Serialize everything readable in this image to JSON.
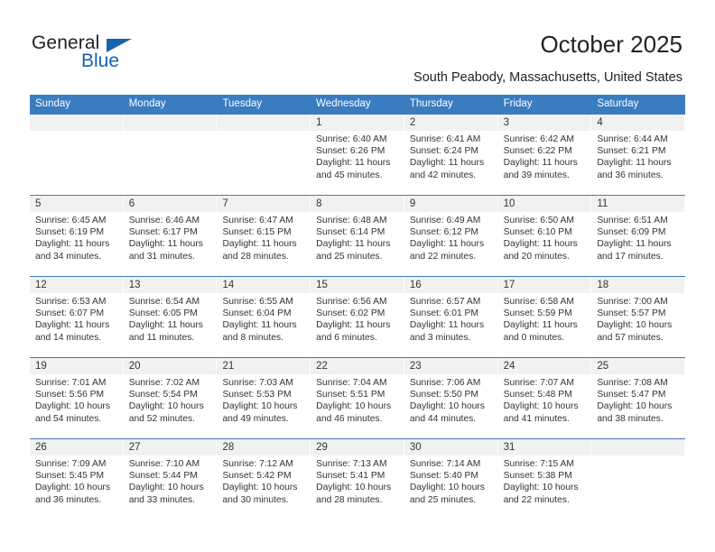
{
  "brand": {
    "name_part1": "General",
    "name_part2": "Blue",
    "accent_color": "#1565ae"
  },
  "header": {
    "title": "October 2025",
    "subtitle": "South Peabody, Massachusetts, United States"
  },
  "calendar": {
    "header_bg_color": "#3a7cc0",
    "weekdays": [
      "Sunday",
      "Monday",
      "Tuesday",
      "Wednesday",
      "Thursday",
      "Friday",
      "Saturday"
    ],
    "weeks": [
      [
        {
          "day": "",
          "sunrise": "",
          "sunset": "",
          "daylight1": "",
          "daylight2": ""
        },
        {
          "day": "",
          "sunrise": "",
          "sunset": "",
          "daylight1": "",
          "daylight2": ""
        },
        {
          "day": "",
          "sunrise": "",
          "sunset": "",
          "daylight1": "",
          "daylight2": ""
        },
        {
          "day": "1",
          "sunrise": "Sunrise: 6:40 AM",
          "sunset": "Sunset: 6:26 PM",
          "daylight1": "Daylight: 11 hours",
          "daylight2": "and 45 minutes."
        },
        {
          "day": "2",
          "sunrise": "Sunrise: 6:41 AM",
          "sunset": "Sunset: 6:24 PM",
          "daylight1": "Daylight: 11 hours",
          "daylight2": "and 42 minutes."
        },
        {
          "day": "3",
          "sunrise": "Sunrise: 6:42 AM",
          "sunset": "Sunset: 6:22 PM",
          "daylight1": "Daylight: 11 hours",
          "daylight2": "and 39 minutes."
        },
        {
          "day": "4",
          "sunrise": "Sunrise: 6:44 AM",
          "sunset": "Sunset: 6:21 PM",
          "daylight1": "Daylight: 11 hours",
          "daylight2": "and 36 minutes."
        }
      ],
      [
        {
          "day": "5",
          "sunrise": "Sunrise: 6:45 AM",
          "sunset": "Sunset: 6:19 PM",
          "daylight1": "Daylight: 11 hours",
          "daylight2": "and 34 minutes."
        },
        {
          "day": "6",
          "sunrise": "Sunrise: 6:46 AM",
          "sunset": "Sunset: 6:17 PM",
          "daylight1": "Daylight: 11 hours",
          "daylight2": "and 31 minutes."
        },
        {
          "day": "7",
          "sunrise": "Sunrise: 6:47 AM",
          "sunset": "Sunset: 6:15 PM",
          "daylight1": "Daylight: 11 hours",
          "daylight2": "and 28 minutes."
        },
        {
          "day": "8",
          "sunrise": "Sunrise: 6:48 AM",
          "sunset": "Sunset: 6:14 PM",
          "daylight1": "Daylight: 11 hours",
          "daylight2": "and 25 minutes."
        },
        {
          "day": "9",
          "sunrise": "Sunrise: 6:49 AM",
          "sunset": "Sunset: 6:12 PM",
          "daylight1": "Daylight: 11 hours",
          "daylight2": "and 22 minutes."
        },
        {
          "day": "10",
          "sunrise": "Sunrise: 6:50 AM",
          "sunset": "Sunset: 6:10 PM",
          "daylight1": "Daylight: 11 hours",
          "daylight2": "and 20 minutes."
        },
        {
          "day": "11",
          "sunrise": "Sunrise: 6:51 AM",
          "sunset": "Sunset: 6:09 PM",
          "daylight1": "Daylight: 11 hours",
          "daylight2": "and 17 minutes."
        }
      ],
      [
        {
          "day": "12",
          "sunrise": "Sunrise: 6:53 AM",
          "sunset": "Sunset: 6:07 PM",
          "daylight1": "Daylight: 11 hours",
          "daylight2": "and 14 minutes."
        },
        {
          "day": "13",
          "sunrise": "Sunrise: 6:54 AM",
          "sunset": "Sunset: 6:05 PM",
          "daylight1": "Daylight: 11 hours",
          "daylight2": "and 11 minutes."
        },
        {
          "day": "14",
          "sunrise": "Sunrise: 6:55 AM",
          "sunset": "Sunset: 6:04 PM",
          "daylight1": "Daylight: 11 hours",
          "daylight2": "and 8 minutes."
        },
        {
          "day": "15",
          "sunrise": "Sunrise: 6:56 AM",
          "sunset": "Sunset: 6:02 PM",
          "daylight1": "Daylight: 11 hours",
          "daylight2": "and 6 minutes."
        },
        {
          "day": "16",
          "sunrise": "Sunrise: 6:57 AM",
          "sunset": "Sunset: 6:01 PM",
          "daylight1": "Daylight: 11 hours",
          "daylight2": "and 3 minutes."
        },
        {
          "day": "17",
          "sunrise": "Sunrise: 6:58 AM",
          "sunset": "Sunset: 5:59 PM",
          "daylight1": "Daylight: 11 hours",
          "daylight2": "and 0 minutes."
        },
        {
          "day": "18",
          "sunrise": "Sunrise: 7:00 AM",
          "sunset": "Sunset: 5:57 PM",
          "daylight1": "Daylight: 10 hours",
          "daylight2": "and 57 minutes."
        }
      ],
      [
        {
          "day": "19",
          "sunrise": "Sunrise: 7:01 AM",
          "sunset": "Sunset: 5:56 PM",
          "daylight1": "Daylight: 10 hours",
          "daylight2": "and 54 minutes."
        },
        {
          "day": "20",
          "sunrise": "Sunrise: 7:02 AM",
          "sunset": "Sunset: 5:54 PM",
          "daylight1": "Daylight: 10 hours",
          "daylight2": "and 52 minutes."
        },
        {
          "day": "21",
          "sunrise": "Sunrise: 7:03 AM",
          "sunset": "Sunset: 5:53 PM",
          "daylight1": "Daylight: 10 hours",
          "daylight2": "and 49 minutes."
        },
        {
          "day": "22",
          "sunrise": "Sunrise: 7:04 AM",
          "sunset": "Sunset: 5:51 PM",
          "daylight1": "Daylight: 10 hours",
          "daylight2": "and 46 minutes."
        },
        {
          "day": "23",
          "sunrise": "Sunrise: 7:06 AM",
          "sunset": "Sunset: 5:50 PM",
          "daylight1": "Daylight: 10 hours",
          "daylight2": "and 44 minutes."
        },
        {
          "day": "24",
          "sunrise": "Sunrise: 7:07 AM",
          "sunset": "Sunset: 5:48 PM",
          "daylight1": "Daylight: 10 hours",
          "daylight2": "and 41 minutes."
        },
        {
          "day": "25",
          "sunrise": "Sunrise: 7:08 AM",
          "sunset": "Sunset: 5:47 PM",
          "daylight1": "Daylight: 10 hours",
          "daylight2": "and 38 minutes."
        }
      ],
      [
        {
          "day": "26",
          "sunrise": "Sunrise: 7:09 AM",
          "sunset": "Sunset: 5:45 PM",
          "daylight1": "Daylight: 10 hours",
          "daylight2": "and 36 minutes."
        },
        {
          "day": "27",
          "sunrise": "Sunrise: 7:10 AM",
          "sunset": "Sunset: 5:44 PM",
          "daylight1": "Daylight: 10 hours",
          "daylight2": "and 33 minutes."
        },
        {
          "day": "28",
          "sunrise": "Sunrise: 7:12 AM",
          "sunset": "Sunset: 5:42 PM",
          "daylight1": "Daylight: 10 hours",
          "daylight2": "and 30 minutes."
        },
        {
          "day": "29",
          "sunrise": "Sunrise: 7:13 AM",
          "sunset": "Sunset: 5:41 PM",
          "daylight1": "Daylight: 10 hours",
          "daylight2": "and 28 minutes."
        },
        {
          "day": "30",
          "sunrise": "Sunrise: 7:14 AM",
          "sunset": "Sunset: 5:40 PM",
          "daylight1": "Daylight: 10 hours",
          "daylight2": "and 25 minutes."
        },
        {
          "day": "31",
          "sunrise": "Sunrise: 7:15 AM",
          "sunset": "Sunset: 5:38 PM",
          "daylight1": "Daylight: 10 hours",
          "daylight2": "and 22 minutes."
        },
        {
          "day": "",
          "sunrise": "",
          "sunset": "",
          "daylight1": "",
          "daylight2": ""
        }
      ]
    ]
  }
}
